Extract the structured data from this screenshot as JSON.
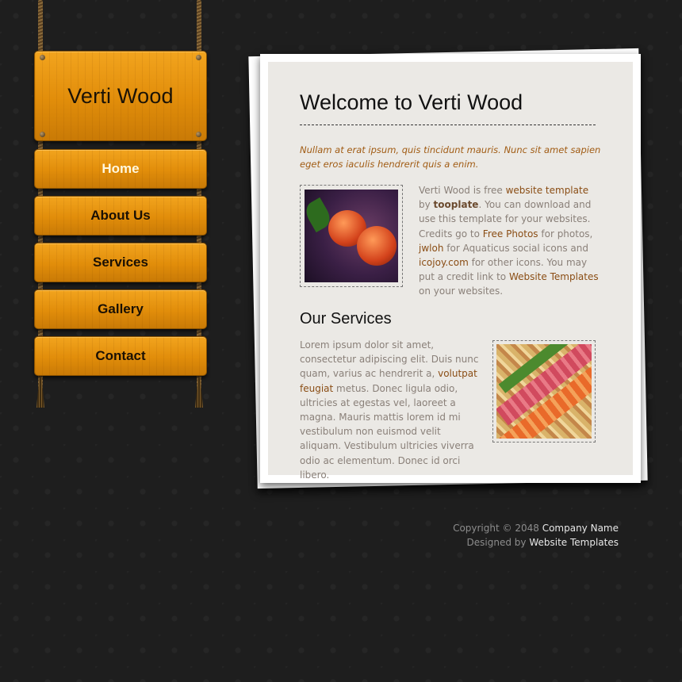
{
  "site": {
    "logo_text": "Verti Wood"
  },
  "nav": {
    "items": [
      {
        "label": "Home",
        "active": true
      },
      {
        "label": "About Us",
        "active": false
      },
      {
        "label": "Services",
        "active": false
      },
      {
        "label": "Gallery",
        "active": false
      },
      {
        "label": "Contact",
        "active": false
      }
    ]
  },
  "main": {
    "title": "Welcome to Verti Wood",
    "intro": "Nullam at erat ipsum, quis tincidunt mauris. Nunc sit amet sapien eget eros iaculis hendrerit quis a enim.",
    "para1": {
      "t1": "Verti Wood is free ",
      "link1": "website template",
      "t2": " by ",
      "bold1": "tooplate",
      "t3": ". You can download and use this template for your websites. Credits go to ",
      "link2": "Free Photos",
      "t4": " for photos, ",
      "link3": "jwloh",
      "t5": " for Aquaticus social icons and ",
      "link4": "icojoy.com",
      "t6": " for other icons. You may put a credit link to ",
      "link5": "Website Templates",
      "t7": " on your websites."
    },
    "services_title": "Our Services",
    "para2": {
      "t1": "Lorem ipsum dolor sit amet, consectetur adipiscing elit. Duis nunc quam, varius ac hendrerit a, ",
      "link1": "volutpat feugiat",
      "t2": " metus. Donec ligula odio, ultricies at egestas vel, laoreet a magna. Mauris mattis lorem id mi vestibulum non euismod velit aliquam. Vestibulum ultricies viverra odio ac elementum. Donec id orci libero."
    }
  },
  "footer": {
    "line1_prefix": "Copyright © 2048 ",
    "line1_link": "Company Name",
    "line2_prefix": "Designed by ",
    "line2_link": "Website Templates"
  }
}
